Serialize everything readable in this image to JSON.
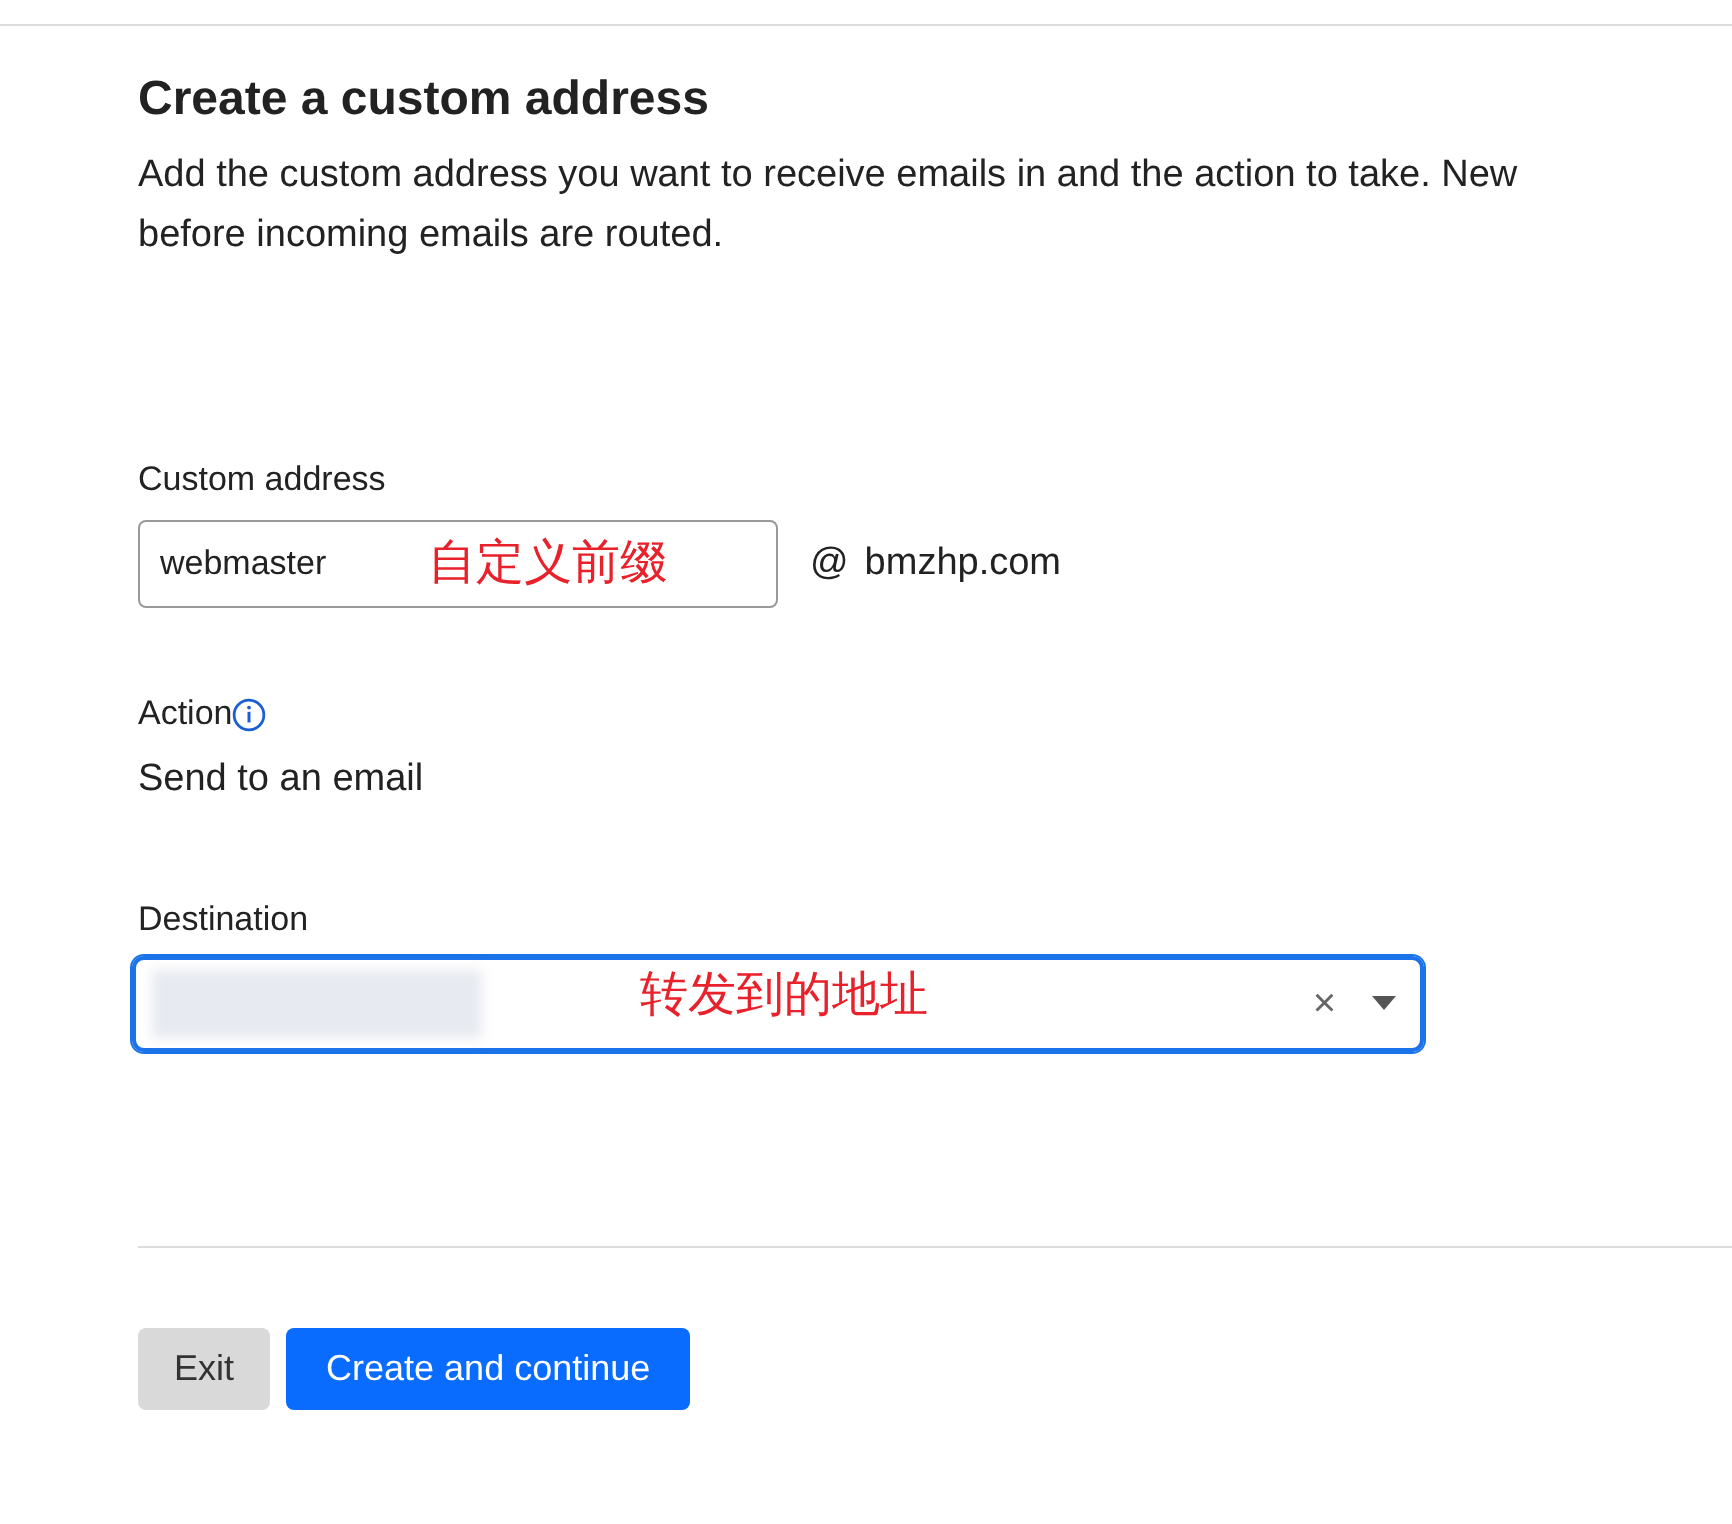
{
  "title": "Create a custom address",
  "description_lines": [
    "Add the custom address you want to receive emails in and the action to take. New",
    "before incoming emails are routed."
  ],
  "custom_address": {
    "label": "Custom address",
    "value": "webmaster",
    "annotation": "自定义前缀",
    "at": "@",
    "domain": "bmzhp.com"
  },
  "action": {
    "label": "Action",
    "value": "Send to an email"
  },
  "destination": {
    "label": "Destination",
    "redacted": true,
    "annotation": "转发到的地址",
    "focused": true,
    "clear": "×"
  },
  "buttons": [
    {
      "label": "Exit",
      "kind": "secondary"
    },
    {
      "label": "Create and continue",
      "kind": "primary"
    }
  ]
}
